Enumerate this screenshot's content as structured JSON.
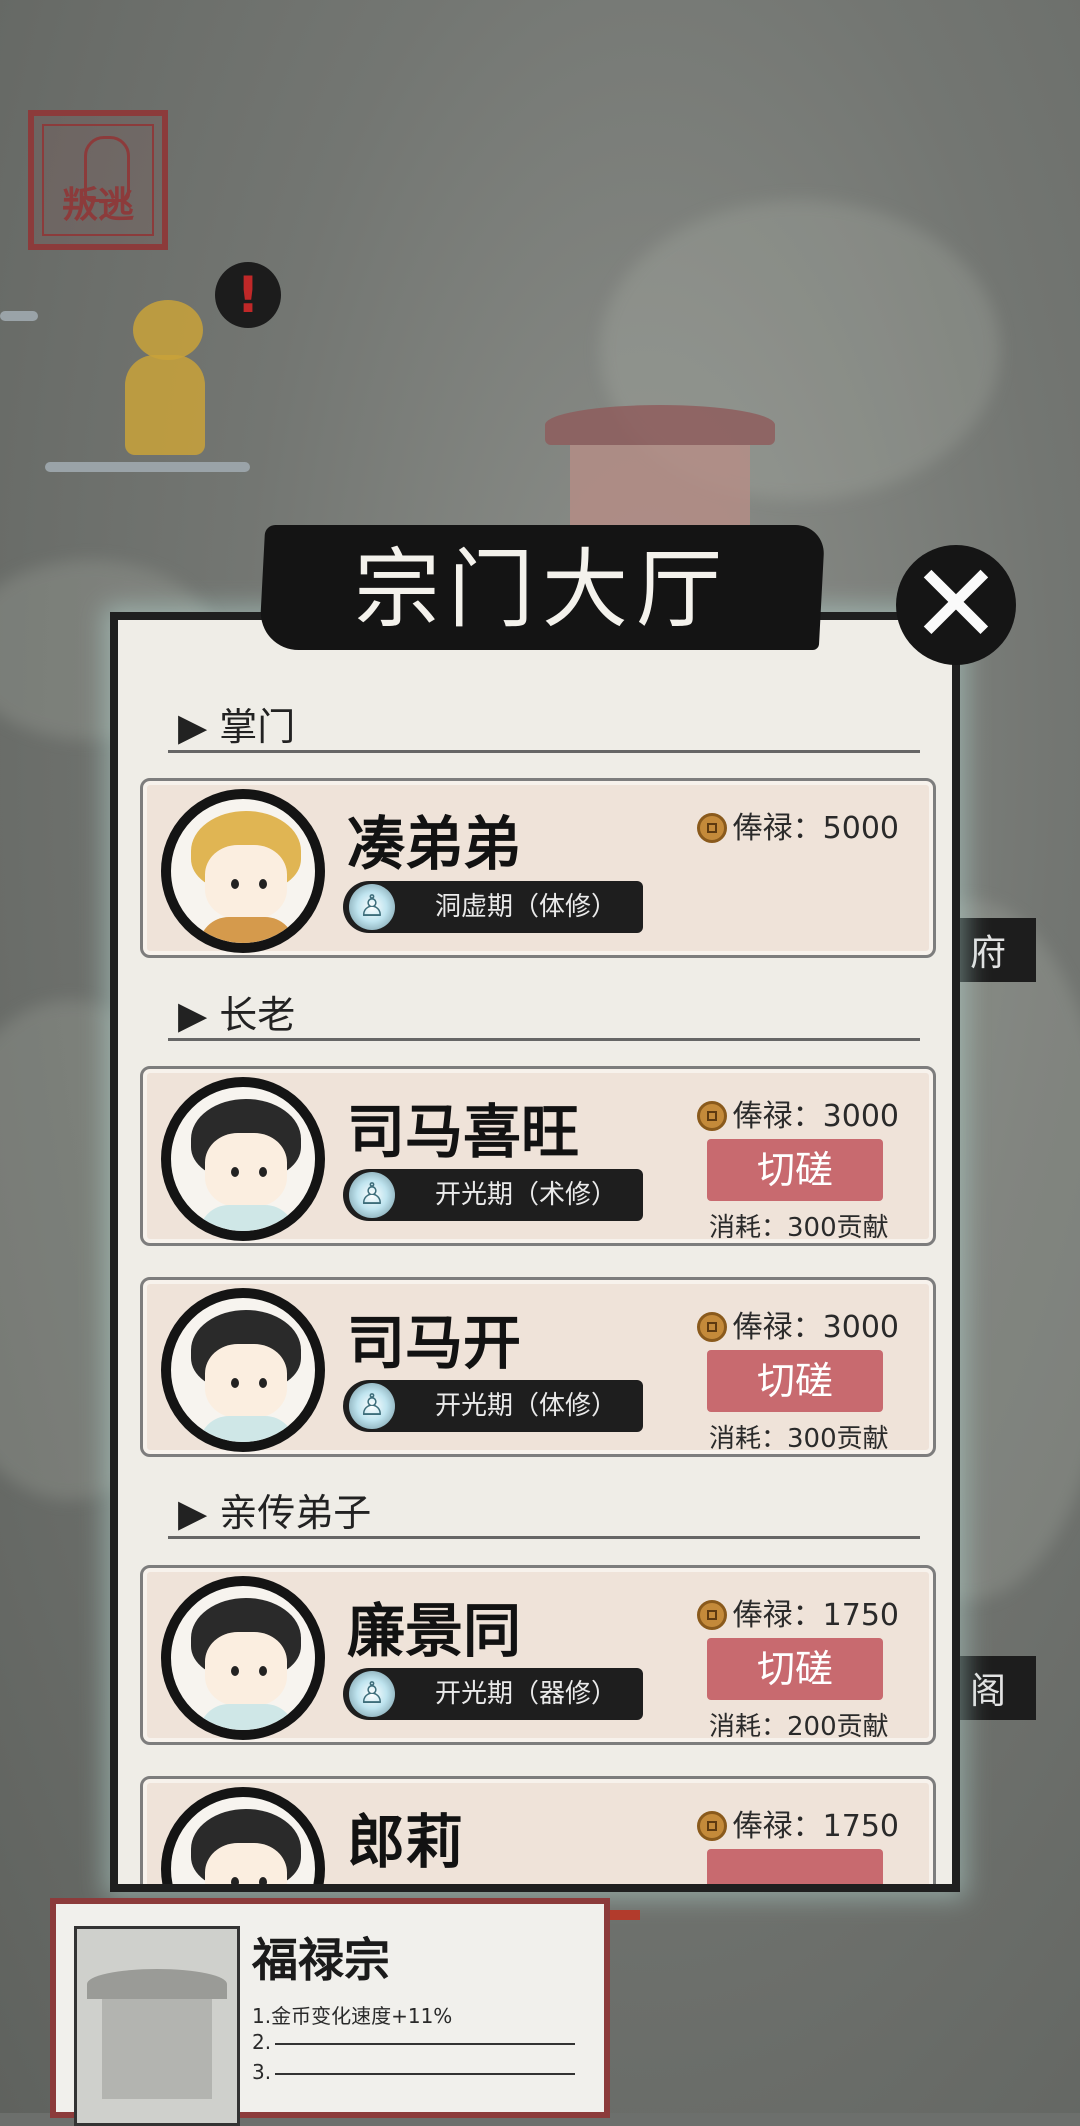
{
  "background": {
    "desert_button_label": "叛逃",
    "side_tabs": [
      "府",
      "阁"
    ]
  },
  "dialog": {
    "title": "宗门大厅",
    "close_icon": "close-icon",
    "sections": {
      "leader": "▶ 掌门",
      "elders": "▶ 长老",
      "disciples": "▶ 亲传弟子"
    },
    "members": [
      {
        "name": "凑弟弟",
        "realm": "洞虚期（体修）",
        "salary": "俸禄：5000"
      },
      {
        "name": "司马喜旺",
        "realm": "开光期（术修）",
        "salary": "俸禄：3000",
        "spar_label": "切磋",
        "cost": "消耗：300贡献"
      },
      {
        "name": "司马开",
        "realm": "开光期（体修）",
        "salary": "俸禄：3000",
        "spar_label": "切磋",
        "cost": "消耗：300贡献"
      },
      {
        "name": "廉景同",
        "realm": "开光期（器修）",
        "salary": "俸禄：1750",
        "spar_label": "切磋",
        "cost": "消耗：200贡献"
      },
      {
        "name": "郎莉",
        "salary": "俸禄：1750"
      }
    ]
  },
  "sect": {
    "name": "福禄宗",
    "lines": [
      "1.金币变化速度+11%",
      "2.",
      "3."
    ]
  },
  "colors": {
    "accent_red": "#8c3b3b",
    "spar_button": "#c86a6f",
    "card_bg": "#efe3d9"
  }
}
